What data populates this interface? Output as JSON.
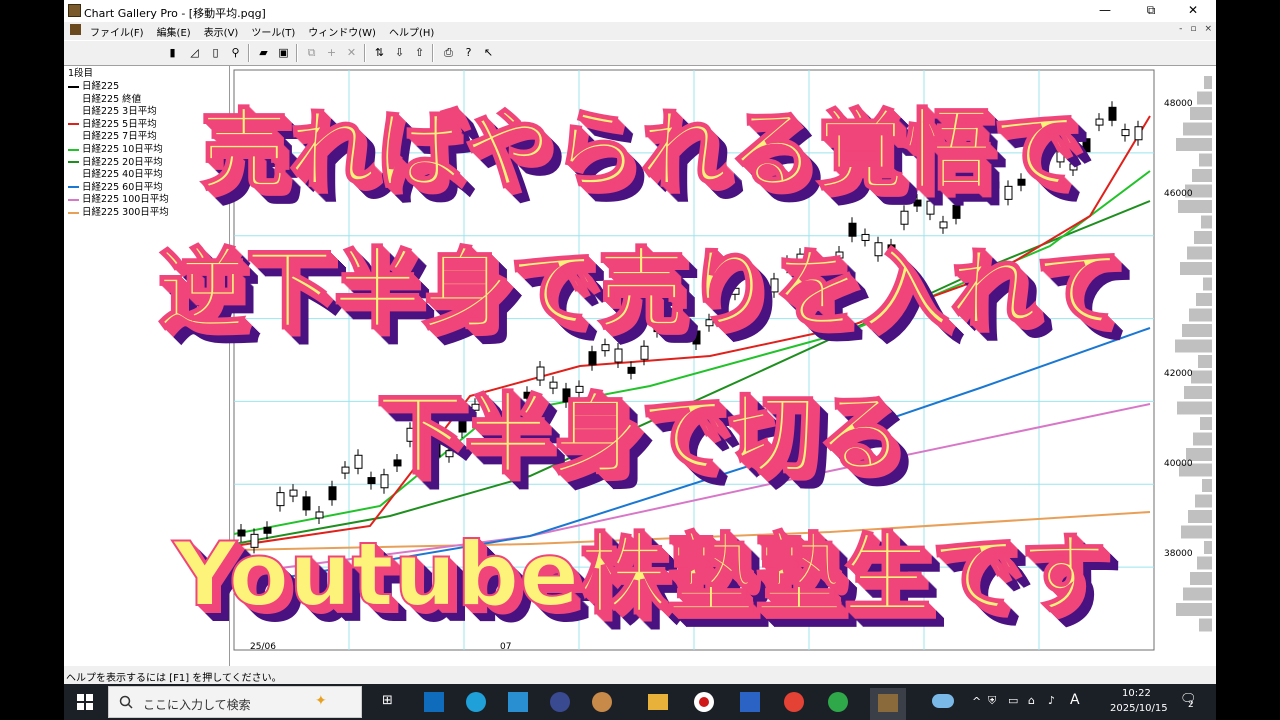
{
  "window": {
    "title": "Chart Gallery Pro - [移動平均.pqg]",
    "minimize": "—",
    "maximize": "⧉",
    "close": "✕"
  },
  "menu": {
    "items": [
      "ファイル(F)",
      "編集(E)",
      "表示(V)",
      "ツール(T)",
      "ウィンドウ(W)",
      "ヘルプ(H)"
    ],
    "mdi": [
      "-",
      "▫",
      "×"
    ]
  },
  "legend": {
    "section": "1段目",
    "entries": [
      {
        "label": "日経225",
        "color": "#000000"
      },
      {
        "label": "日経225 終値",
        "color": ""
      },
      {
        "label": "日経225 3日平均",
        "color": ""
      },
      {
        "label": "日経225 5日平均",
        "color": "#e0201a"
      },
      {
        "label": "日経225 7日平均",
        "color": ""
      },
      {
        "label": "日経225 10日平均",
        "color": "#22c22a"
      },
      {
        "label": "日経225 20日平均",
        "color": "#1e8f1e"
      },
      {
        "label": "日経225 40日平均",
        "color": ""
      },
      {
        "label": "日経225 60日平均",
        "color": "#1a78d2"
      },
      {
        "label": "日経225 100日平均",
        "color": "#d877c8"
      },
      {
        "label": "日経225 300日平均",
        "color": "#e8a058"
      }
    ]
  },
  "chart_data": {
    "type": "line",
    "y_ticks": [
      "48000",
      "46000",
      "42000",
      "40000",
      "38000"
    ],
    "x_ticks": [
      "25/06",
      "07"
    ],
    "ylim": [
      37000,
      49000
    ],
    "grid": true
  },
  "status": {
    "text": "ヘルプを表示するには [F1] を押してください。"
  },
  "taskbar": {
    "search_placeholder": "ここに入力して検索",
    "ime": "A",
    "time": "10:22",
    "date": "2025/10/15",
    "notification_count": "2"
  },
  "overlay": {
    "lines": [
      "売ればやられる覚悟で",
      "逆下半身で売りを入れて",
      "下半身で切る",
      "Youtube株塾塾生です"
    ],
    "text_color": "#fdf27a",
    "shadow_pink": "#f0457a",
    "shadow_purple": "#4a1280"
  }
}
